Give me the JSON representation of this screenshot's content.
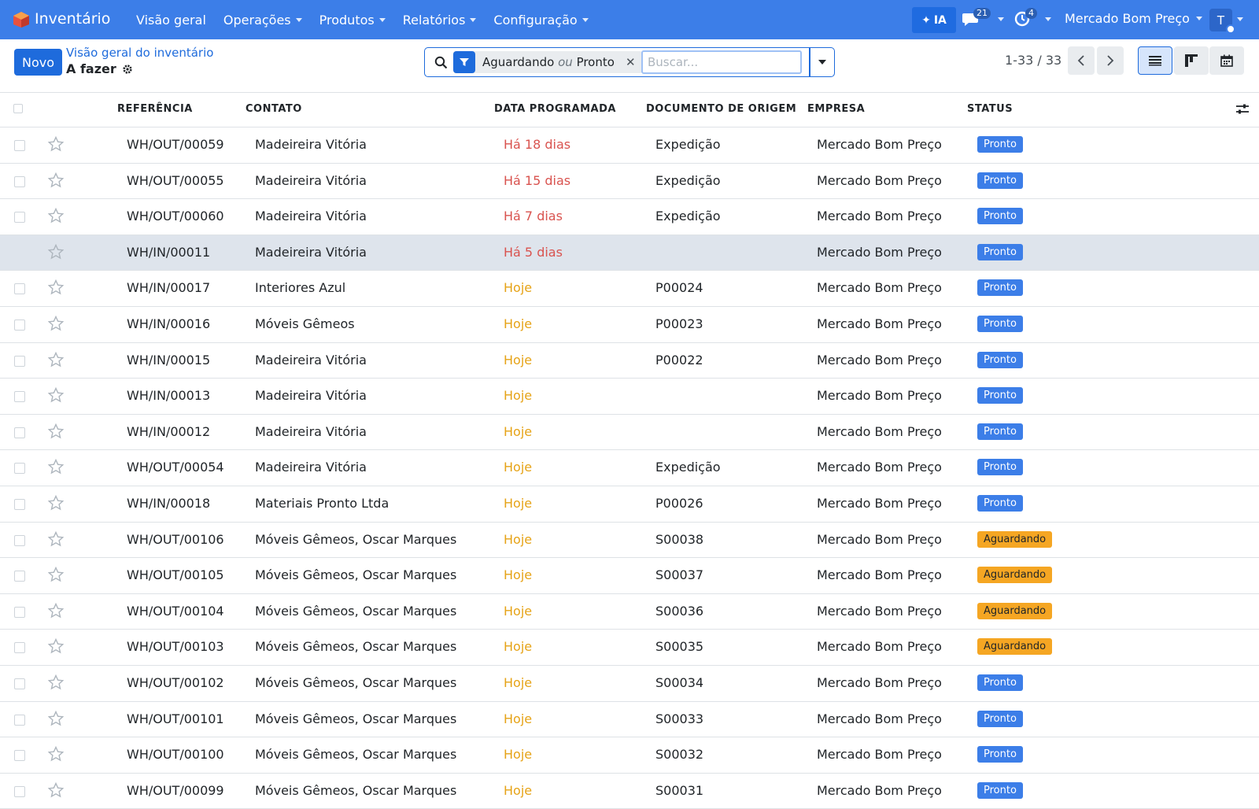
{
  "navbar": {
    "app_name": "Inventário",
    "menu": [
      {
        "label": "Visão geral",
        "dropdown": false
      },
      {
        "label": "Operações",
        "dropdown": true
      },
      {
        "label": "Produtos",
        "dropdown": true
      },
      {
        "label": "Relatórios",
        "dropdown": true
      },
      {
        "label": "Configuração",
        "dropdown": true
      }
    ],
    "ai_label": "IA",
    "messages_count": "21",
    "activities_count": "4",
    "company": "Mercado Bom Preço",
    "avatar_initial": "T"
  },
  "control": {
    "new_label": "Novo",
    "breadcrumb": "Visão geral do inventário",
    "title": "A fazer",
    "facet": {
      "first": "Aguardando",
      "or": "ou",
      "second": "Pronto"
    },
    "search_placeholder": "Buscar...",
    "pager": "1-33 / 33"
  },
  "table": {
    "headers": {
      "reference": "REFERÊNCIA",
      "contact": "CONTATO",
      "date": "DATA PROGRAMADA",
      "origin": "DOCUMENTO DE ORIGEM",
      "company": "EMPRESA",
      "status": "STATUS"
    },
    "rows": [
      {
        "ref": "WH/OUT/00059",
        "contact": "Madeireira Vitória",
        "date": "Há 18 dias",
        "date_state": "late",
        "origin": "Expedição",
        "company": "Mercado Bom Preço",
        "status": "Pronto",
        "status_type": "ready"
      },
      {
        "ref": "WH/OUT/00055",
        "contact": "Madeireira Vitória",
        "date": "Há 15 dias",
        "date_state": "late",
        "origin": "Expedição",
        "company": "Mercado Bom Preço",
        "status": "Pronto",
        "status_type": "ready"
      },
      {
        "ref": "WH/OUT/00060",
        "contact": "Madeireira Vitória",
        "date": "Há 7 dias",
        "date_state": "late",
        "origin": "Expedição",
        "company": "Mercado Bom Preço",
        "status": "Pronto",
        "status_type": "ready"
      },
      {
        "ref": "WH/IN/00011",
        "contact": "Madeireira Vitória",
        "date": "Há 5 dias",
        "date_state": "late",
        "origin": "",
        "company": "Mercado Bom Preço",
        "status": "Pronto",
        "status_type": "ready",
        "highlight": true
      },
      {
        "ref": "WH/IN/00017",
        "contact": "Interiores Azul",
        "date": "Hoje",
        "date_state": "today",
        "origin": "P00024",
        "company": "Mercado Bom Preço",
        "status": "Pronto",
        "status_type": "ready"
      },
      {
        "ref": "WH/IN/00016",
        "contact": "Móveis Gêmeos",
        "date": "Hoje",
        "date_state": "today",
        "origin": "P00023",
        "company": "Mercado Bom Preço",
        "status": "Pronto",
        "status_type": "ready"
      },
      {
        "ref": "WH/IN/00015",
        "contact": "Madeireira Vitória",
        "date": "Hoje",
        "date_state": "today",
        "origin": "P00022",
        "company": "Mercado Bom Preço",
        "status": "Pronto",
        "status_type": "ready"
      },
      {
        "ref": "WH/IN/00013",
        "contact": "Madeireira Vitória",
        "date": "Hoje",
        "date_state": "today",
        "origin": "",
        "company": "Mercado Bom Preço",
        "status": "Pronto",
        "status_type": "ready"
      },
      {
        "ref": "WH/IN/00012",
        "contact": "Madeireira Vitória",
        "date": "Hoje",
        "date_state": "today",
        "origin": "",
        "company": "Mercado Bom Preço",
        "status": "Pronto",
        "status_type": "ready"
      },
      {
        "ref": "WH/OUT/00054",
        "contact": "Madeireira Vitória",
        "date": "Hoje",
        "date_state": "today",
        "origin": "Expedição",
        "company": "Mercado Bom Preço",
        "status": "Pronto",
        "status_type": "ready"
      },
      {
        "ref": "WH/IN/00018",
        "contact": "Materiais Pronto Ltda",
        "date": "Hoje",
        "date_state": "today",
        "origin": "P00026",
        "company": "Mercado Bom Preço",
        "status": "Pronto",
        "status_type": "ready"
      },
      {
        "ref": "WH/OUT/00106",
        "contact": "Móveis Gêmeos, Oscar Marques",
        "date": "Hoje",
        "date_state": "today",
        "origin": "S00038",
        "company": "Mercado Bom Preço",
        "status": "Aguardando",
        "status_type": "waiting"
      },
      {
        "ref": "WH/OUT/00105",
        "contact": "Móveis Gêmeos, Oscar Marques",
        "date": "Hoje",
        "date_state": "today",
        "origin": "S00037",
        "company": "Mercado Bom Preço",
        "status": "Aguardando",
        "status_type": "waiting"
      },
      {
        "ref": "WH/OUT/00104",
        "contact": "Móveis Gêmeos, Oscar Marques",
        "date": "Hoje",
        "date_state": "today",
        "origin": "S00036",
        "company": "Mercado Bom Preço",
        "status": "Aguardando",
        "status_type": "waiting"
      },
      {
        "ref": "WH/OUT/00103",
        "contact": "Móveis Gêmeos, Oscar Marques",
        "date": "Hoje",
        "date_state": "today",
        "origin": "S00035",
        "company": "Mercado Bom Preço",
        "status": "Aguardando",
        "status_type": "waiting"
      },
      {
        "ref": "WH/OUT/00102",
        "contact": "Móveis Gêmeos, Oscar Marques",
        "date": "Hoje",
        "date_state": "today",
        "origin": "S00034",
        "company": "Mercado Bom Preço",
        "status": "Pronto",
        "status_type": "ready"
      },
      {
        "ref": "WH/OUT/00101",
        "contact": "Móveis Gêmeos, Oscar Marques",
        "date": "Hoje",
        "date_state": "today",
        "origin": "S00033",
        "company": "Mercado Bom Preço",
        "status": "Pronto",
        "status_type": "ready"
      },
      {
        "ref": "WH/OUT/00100",
        "contact": "Móveis Gêmeos, Oscar Marques",
        "date": "Hoje",
        "date_state": "today",
        "origin": "S00032",
        "company": "Mercado Bom Preço",
        "status": "Pronto",
        "status_type": "ready"
      },
      {
        "ref": "WH/OUT/00099",
        "contact": "Móveis Gêmeos, Oscar Marques",
        "date": "Hoje",
        "date_state": "today",
        "origin": "S00031",
        "company": "Mercado Bom Preço",
        "status": "Pronto",
        "status_type": "ready"
      }
    ]
  },
  "colors": {
    "navbar": "#3c7ee8",
    "primary": "#1e6bdc",
    "late": "#d9534f",
    "today": "#e6a317",
    "ready": "#3c7ee8",
    "waiting": "#f5a623"
  },
  "icons": [
    "app-logo-icon",
    "search-icon",
    "filter-icon",
    "close-icon",
    "chat-icon",
    "activity-clock-icon",
    "chevron-left-icon",
    "chevron-right-icon",
    "list-view-icon",
    "kanban-view-icon",
    "calendar-view-icon",
    "star-icon",
    "gear-icon",
    "optional-columns-icon"
  ]
}
